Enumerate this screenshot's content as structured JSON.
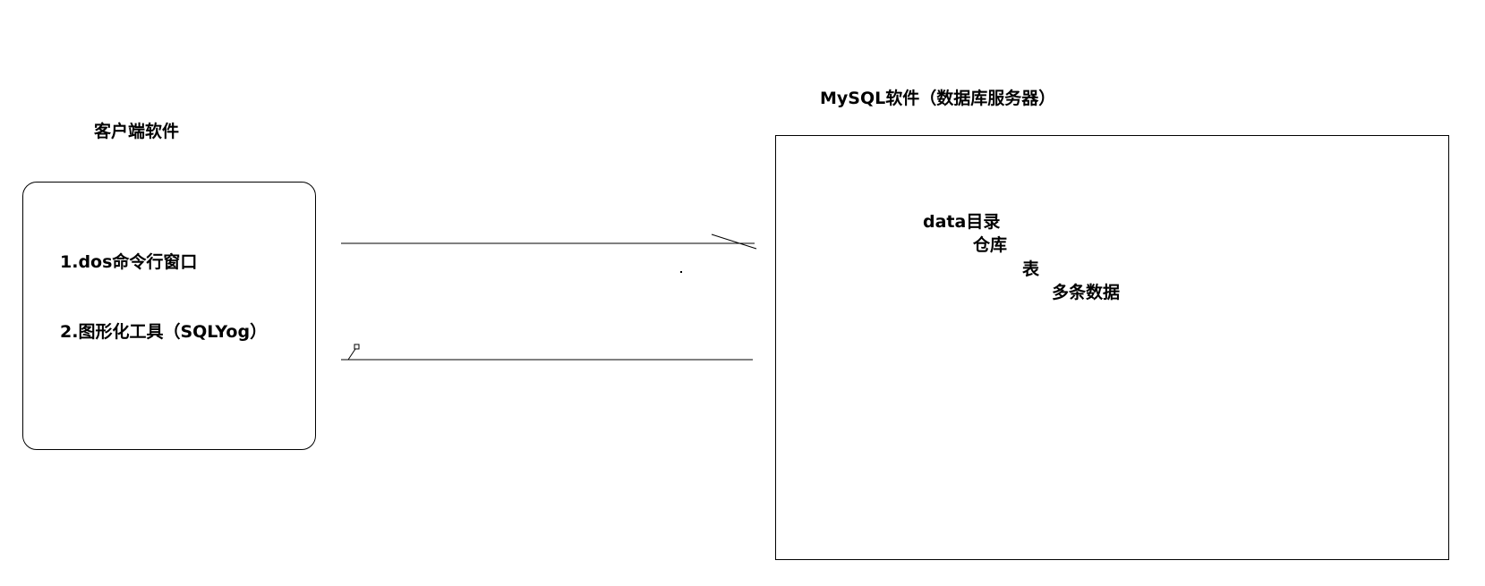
{
  "client": {
    "title": "客户端软件",
    "items": [
      "1.dos命令行窗口",
      "2.图形化工具（SQLYog）"
    ]
  },
  "server": {
    "title": "MySQL软件（数据库服务器）",
    "tree": {
      "data_dir": "data目录",
      "database": "仓库",
      "table": "表",
      "rows": "多条数据"
    }
  }
}
